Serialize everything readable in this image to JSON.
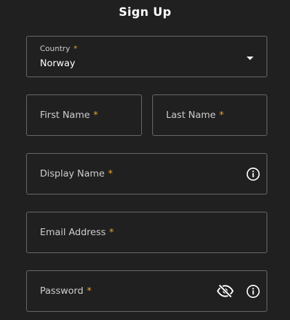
{
  "title": "Sign Up",
  "required_mark": "*",
  "accent": "#f0a42a",
  "fields": {
    "country": {
      "label": "Country",
      "value": "Norway",
      "icon": "chevron-down-icon"
    },
    "first_name": {
      "label": "First Name"
    },
    "last_name": {
      "label": "Last Name"
    },
    "display_name": {
      "label": "Display Name",
      "icon": "info-icon"
    },
    "email": {
      "label": "Email Address"
    },
    "password": {
      "label": "Password",
      "icons": [
        "eye-slash-icon",
        "info-icon"
      ]
    }
  }
}
